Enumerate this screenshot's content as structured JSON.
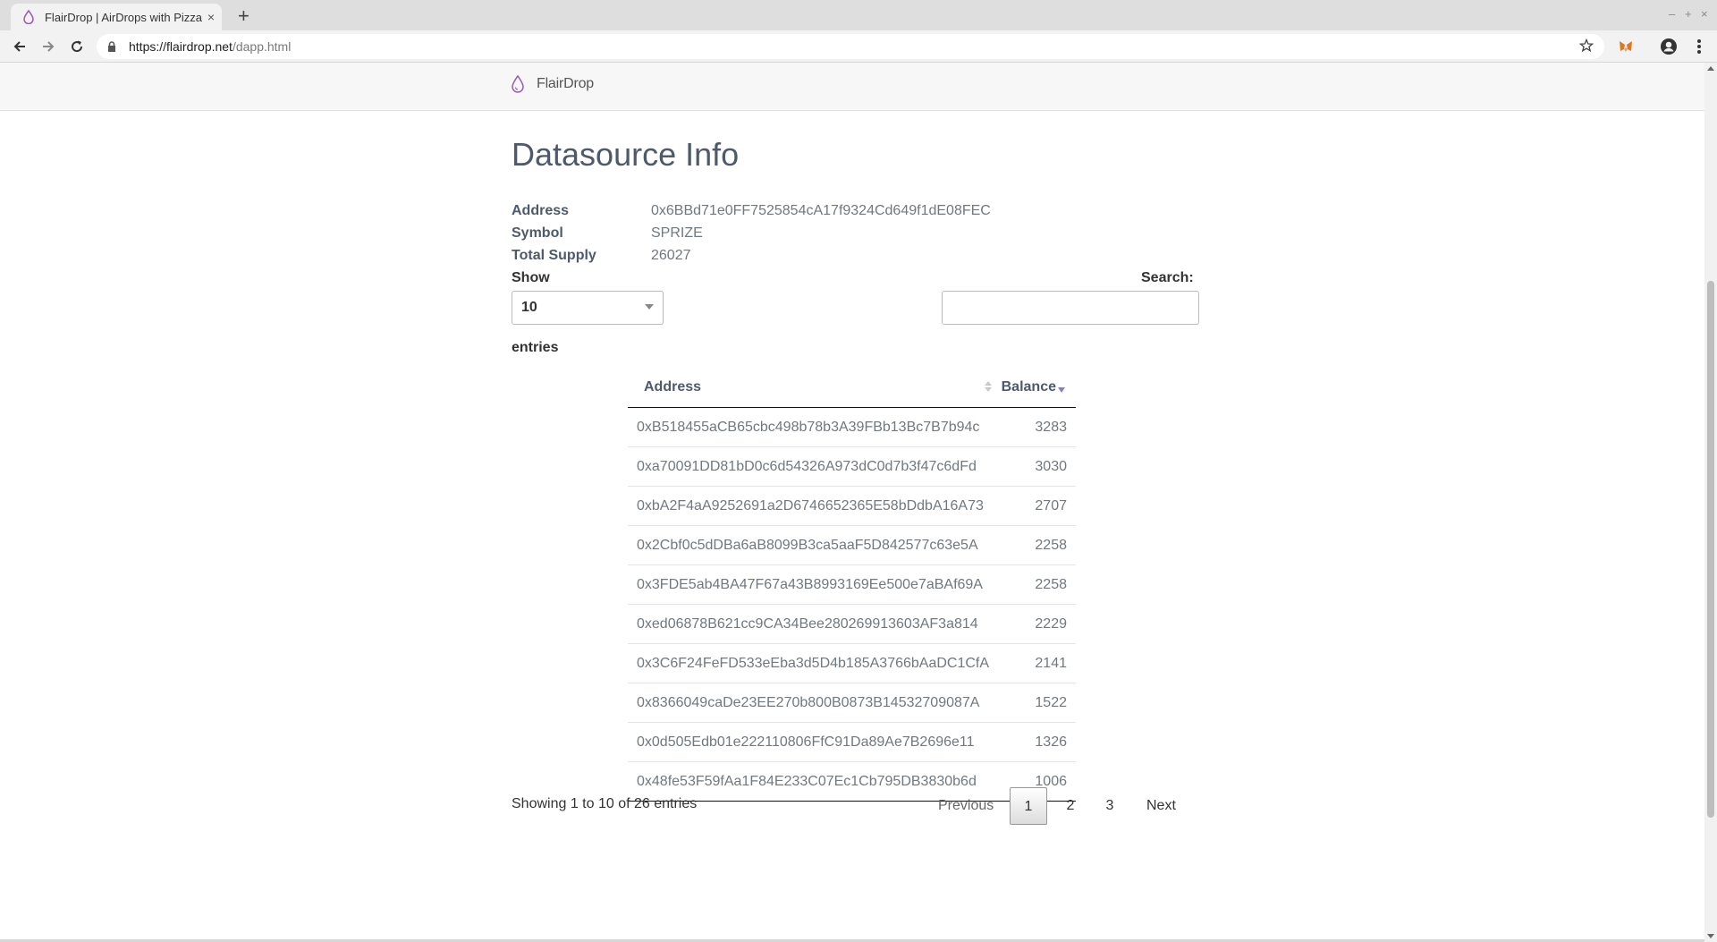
{
  "browser": {
    "tab_title": "FlairDrop | AirDrops with Pizzazz",
    "new_tab": "+",
    "tab_close": "×",
    "url_host": "https://flairdrop.net",
    "url_path": "/dapp.html",
    "window_controls": [
      "–",
      "+",
      "×"
    ]
  },
  "header": {
    "brand": "FlairDrop",
    "brand_color": "#9b59b6"
  },
  "page": {
    "title": "Datasource Info",
    "info": [
      {
        "label": "Address",
        "value": "0x6BBd71e0FF7525854cA17f9324Cd649f1dE08FEC"
      },
      {
        "label": "Symbol",
        "value": "SPRIZE"
      },
      {
        "label": "Total Supply",
        "value": "26027"
      }
    ]
  },
  "table_controls": {
    "show_label": "Show",
    "length_value": "10",
    "search_label": "Search:",
    "search_value": "",
    "entries_label": "entries"
  },
  "table": {
    "columns": [
      "Address",
      "Balance"
    ],
    "sort": {
      "column": "Balance",
      "direction": "desc",
      "icon_color": "#7b82d0"
    },
    "rows": [
      {
        "address": "0xB518455aCB65cbc498b78b3A39FBb13Bc7B7b94c",
        "balance": "3283"
      },
      {
        "address": "0xa70091DD81bD0c6d54326A973dC0d7b3f47c6dFd",
        "balance": "3030"
      },
      {
        "address": "0xbA2F4aA9252691a2D6746652365E58bDdbA16A73",
        "balance": "2707"
      },
      {
        "address": "0x2Cbf0c5dDBa6aB8099B3ca5aaF5D842577c63e5A",
        "balance": "2258"
      },
      {
        "address": "0x3FDE5ab4BA47F67a43B8993169Ee500e7aBAf69A",
        "balance": "2258"
      },
      {
        "address": "0xed06878B621cc9CA34Bee280269913603AF3a814",
        "balance": "2229"
      },
      {
        "address": "0x3C6F24FeFD533eEba3d5D4b185A3766bAaDC1CfA",
        "balance": "2141"
      },
      {
        "address": "0x8366049caDe23EE270b800B0873B14532709087A",
        "balance": "1522"
      },
      {
        "address": "0x0d505Edb01e222110806FfC91Da89Ae7B2696e11",
        "balance": "1326"
      },
      {
        "address": "0x48fe53F59fAa1F84E233C07Ec1Cb795DB3830b6d",
        "balance": "1006"
      }
    ]
  },
  "pagination": {
    "status": "Showing 1 to 10 of 26 entries",
    "previous": "Previous",
    "pages": [
      "1",
      "2",
      "3"
    ],
    "current_page": "1",
    "next": "Next"
  }
}
